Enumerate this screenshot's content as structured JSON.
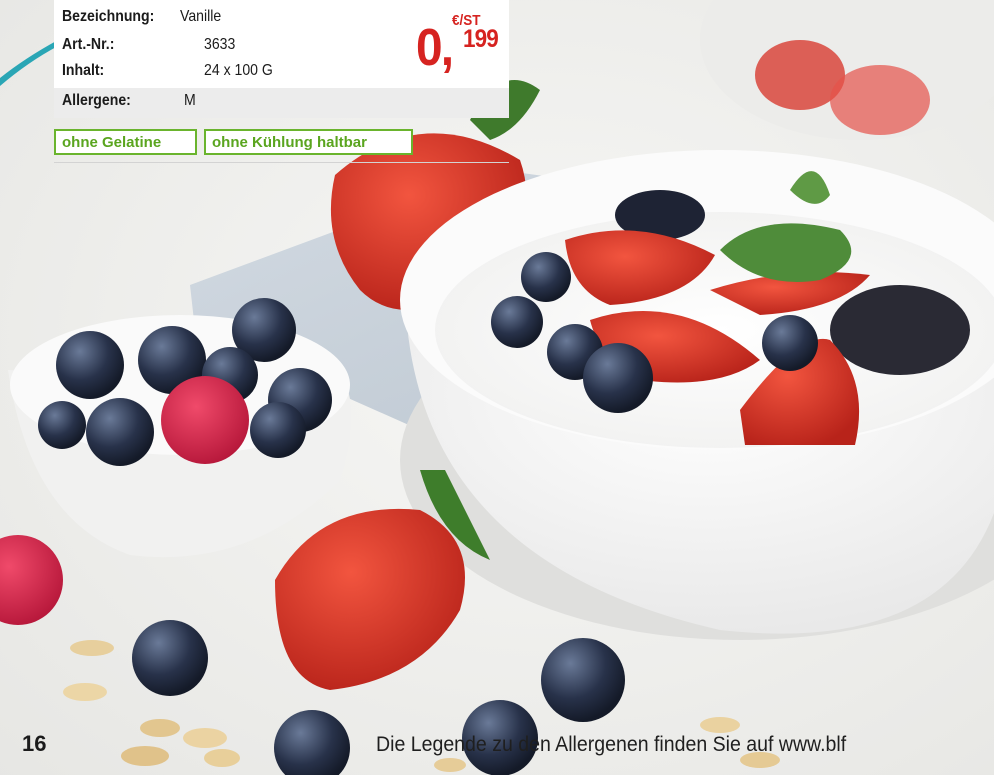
{
  "product": {
    "name_label": "Bezeichnung:",
    "name_value": "Vanille",
    "article_label": "Art.-Nr.:",
    "article_value": "3633",
    "content_label": "Inhalt:",
    "content_value": "24 x 100 G",
    "allergens_label": "Allergene:",
    "allergens_value": "M"
  },
  "price": {
    "unit": "€/ST",
    "main": "0,",
    "cents": "199",
    "color": "#d62320"
  },
  "badges": [
    {
      "label": "ohne Gelatine"
    },
    {
      "label": "ohne Kühlung haltbar"
    }
  ],
  "badge_color": "#6ab42d",
  "footer": {
    "page_number": "16",
    "note": "Die Legende zu den Allergenen finden Sie auf www.blf"
  },
  "accent_teal": "#2aa6b5"
}
